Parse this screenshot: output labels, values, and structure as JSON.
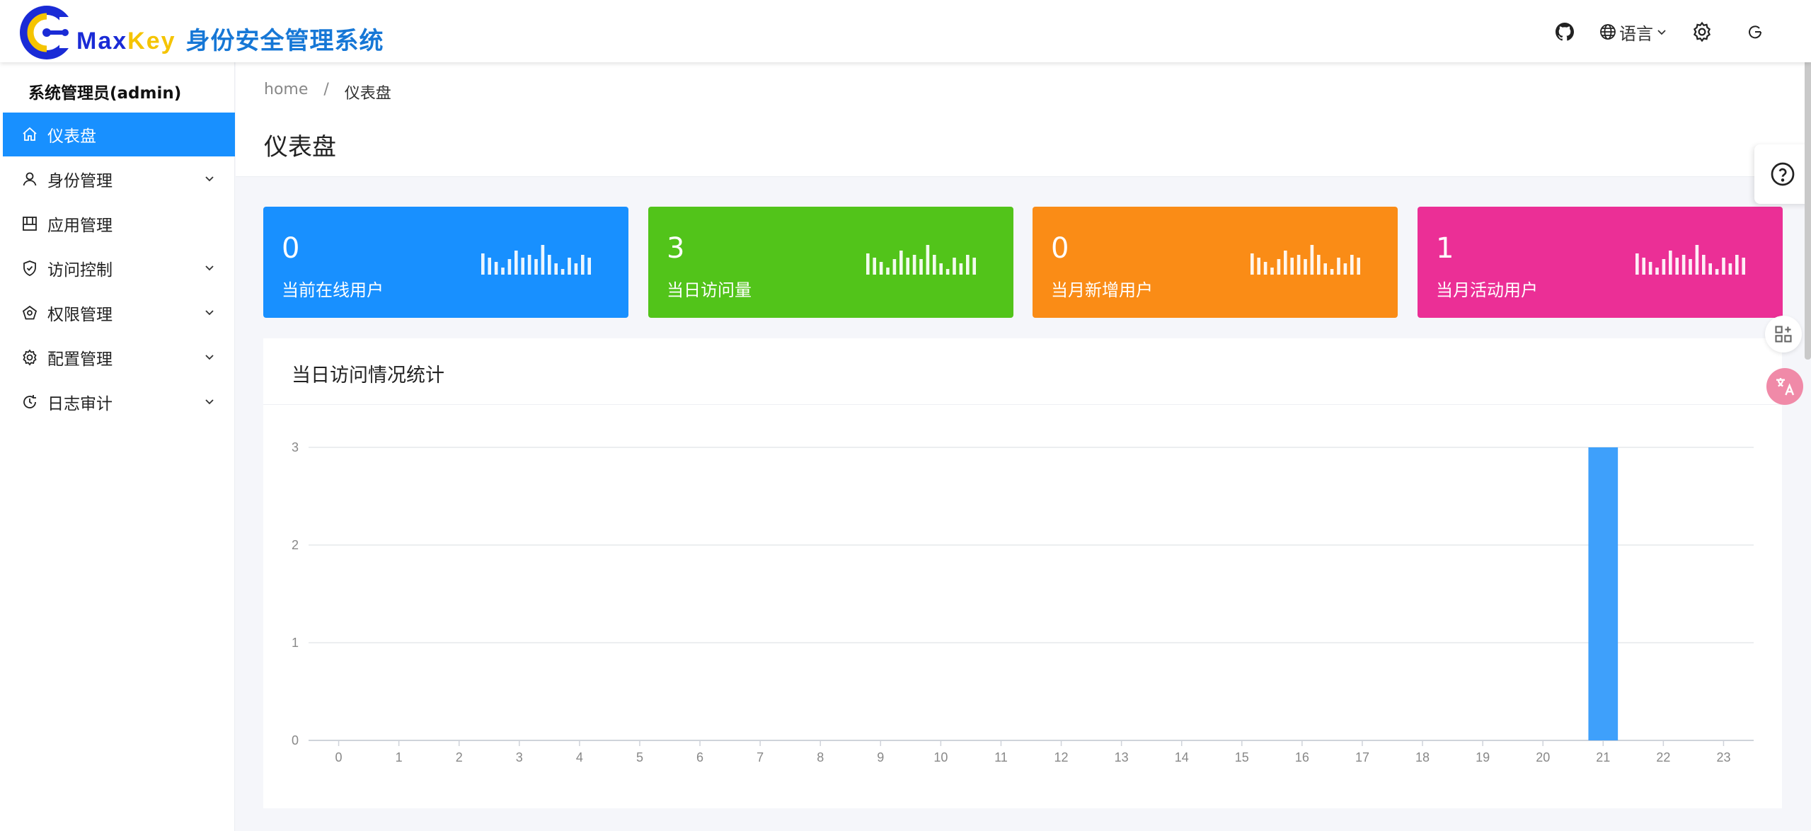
{
  "header": {
    "brand_max": "Max",
    "brand_key": "Key",
    "brand_system": "身份安全管理系统",
    "language_label": "语言",
    "icons": [
      "github-icon",
      "globe-icon",
      "chevron-down-icon",
      "gear-icon",
      "power-icon"
    ]
  },
  "sidebar": {
    "user": "系统管理员(admin)",
    "items": [
      {
        "label": "仪表盘",
        "icon": "home-icon",
        "active": true,
        "expandable": false
      },
      {
        "label": "身份管理",
        "icon": "user-icon",
        "active": false,
        "expandable": true
      },
      {
        "label": "应用管理",
        "icon": "app-icon",
        "active": false,
        "expandable": false
      },
      {
        "label": "访问控制",
        "icon": "shield-icon",
        "active": false,
        "expandable": true
      },
      {
        "label": "权限管理",
        "icon": "permission-icon",
        "active": false,
        "expandable": true
      },
      {
        "label": "配置管理",
        "icon": "gear-icon",
        "active": false,
        "expandable": true
      },
      {
        "label": "日志审计",
        "icon": "history-icon",
        "active": false,
        "expandable": true
      }
    ]
  },
  "breadcrumb": {
    "home": "home",
    "separator": "/",
    "current": "仪表盘"
  },
  "page_title": "仪表盘",
  "stats": [
    {
      "value": "0",
      "label": "当前在线用户",
      "color": "#1890ff"
    },
    {
      "value": "3",
      "label": "当日访问量",
      "color": "#52c41a"
    },
    {
      "value": "0",
      "label": "当月新增用户",
      "color": "#fa8c16"
    },
    {
      "value": "1",
      "label": "当月活动用户",
      "color": "#eb2f96"
    }
  ],
  "chart_card": {
    "title": "当日访问情况统计"
  },
  "chart_data": {
    "type": "bar",
    "title": "当日访问情况统计",
    "categories": [
      "0",
      "1",
      "2",
      "3",
      "4",
      "5",
      "6",
      "7",
      "8",
      "9",
      "10",
      "11",
      "12",
      "13",
      "14",
      "15",
      "16",
      "17",
      "18",
      "19",
      "20",
      "21",
      "22",
      "23"
    ],
    "values": [
      0,
      0,
      0,
      0,
      0,
      0,
      0,
      0,
      0,
      0,
      0,
      0,
      0,
      0,
      0,
      0,
      0,
      0,
      0,
      0,
      0,
      3,
      0,
      0
    ],
    "ylim": [
      0,
      3
    ],
    "yticks": [
      0,
      1,
      2,
      3
    ],
    "bar_color": "#3ea0fb",
    "grid": true
  }
}
